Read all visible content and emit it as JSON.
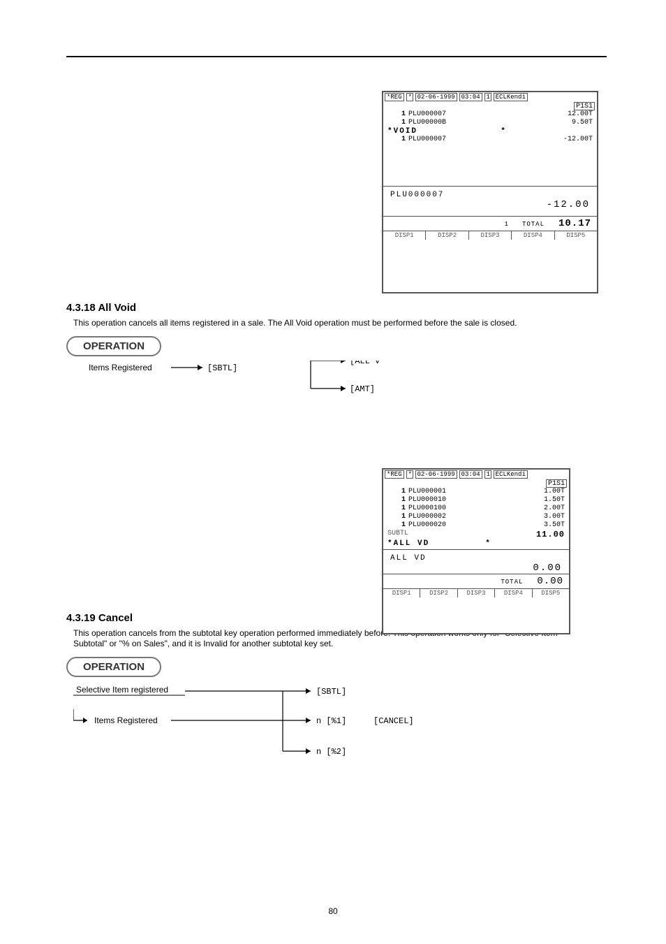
{
  "screen1": {
    "mode": "*REG",
    "star": "*",
    "date": "02-06-1999",
    "time": "03:04",
    "flag": "1",
    "clerk": "ECLKendi",
    "badge": "P1S1",
    "lines": [
      {
        "qty": "1",
        "desc": "PLU000007",
        "amt": "12.00T"
      },
      {
        "qty": "1",
        "desc": "PLU00000B",
        "amt": "9.50T"
      }
    ],
    "void_left": "*VOID",
    "void_right": "*",
    "void_line": {
      "qty": "1",
      "desc": "PLU000007",
      "amt": "-12.00T"
    },
    "big_item": "PLU000007",
    "big_amt": "-12.00",
    "total_count": "1",
    "total_label": "TOTAL",
    "total_value": "10.17",
    "disp": [
      "DISP1",
      "DISP2",
      "DISP3",
      "DISP4",
      "DISP5"
    ]
  },
  "sec_void": {
    "heading": "4.3.18 All Void",
    "para": "This operation cancels all items registered in a sale. The All Void operation must be performed before the sale is closed.",
    "pill": "OPERATION",
    "flow_text": "Items Registered",
    "flow_key1": "[SBTL]",
    "flow_key2": "[ALL VOID]",
    "flow_key3": "[AMT]",
    "flow_key4": "[ALL VOID]"
  },
  "screen2": {
    "mode": "*REG",
    "star": "*",
    "date": "02-06-1999",
    "time": "03:04",
    "flag": "1",
    "clerk": "ECLKendi",
    "badge": "P1S1",
    "lines": [
      {
        "qty": "1",
        "desc": "PLU000001",
        "amt": "1.00T"
      },
      {
        "qty": "1",
        "desc": "PLU000010",
        "amt": "1.50T"
      },
      {
        "qty": "1",
        "desc": "PLU000100",
        "amt": "2.00T"
      },
      {
        "qty": "1",
        "desc": "PLU000002",
        "amt": "3.00T"
      },
      {
        "qty": "1",
        "desc": "PLU000020",
        "amt": "3.50T"
      }
    ],
    "subtl_label": "SUBTL",
    "subtl_value": "11.00",
    "allvd_left": "*ALL VD",
    "allvd_right": "*",
    "big_item": "ALL VD",
    "big_amt": "0.00",
    "total_label": "TOTAL",
    "total_value": "0.00",
    "disp": [
      "DISP1",
      "DISP2",
      "DISP3",
      "DISP4",
      "DISP5"
    ]
  },
  "sec_cancel": {
    "heading": "4.3.19 Cancel",
    "para": "This operation cancels from the subtotal key operation performed immediately before. This operation works only for \"Selective Item Subtotal\" or \"% on Sales\", and it is Invalid for another subtotal key set.",
    "pill": "OPERATION",
    "flow_text_top": "Selective Item registered",
    "flow_key_sbtl": "[SBTL]",
    "flow_text_bot": "Items Registered",
    "flow_pct1": "n [%1]",
    "flow_pct2": "n [%2]",
    "flow_cancel": "[CANCEL]"
  },
  "page_number": "80"
}
